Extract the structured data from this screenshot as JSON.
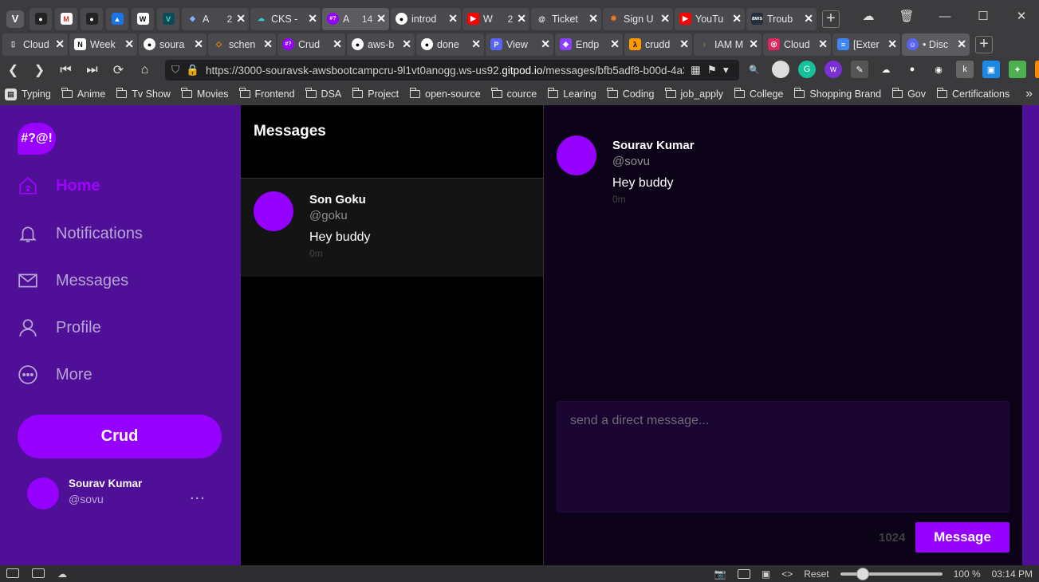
{
  "browser": {
    "tabs_row1": [
      {
        "title": "",
        "favicon": "github-icon",
        "color": "#5a5a5e"
      },
      {
        "title": "",
        "favicon": "gmail-icon",
        "color": "#5a5a5e"
      },
      {
        "title": "",
        "favicon": "github-icon",
        "color": "#5a5a5e"
      },
      {
        "title": "",
        "favicon": "google-drive-icon",
        "color": "#5a5a5e"
      },
      {
        "title": "",
        "favicon": "notion-icon",
        "color": "#5a5a5e"
      },
      {
        "title": "",
        "favicon": "vivaldi-icon",
        "color": "#5a5a5e"
      },
      {
        "title": "A",
        "count": "2",
        "favicon": "cloud-icon",
        "color": "#5a5a5e"
      },
      {
        "title": "CKS -",
        "favicon": "cloud-icon",
        "color": "#4a4a4e"
      },
      {
        "title": "A",
        "count": "14",
        "favicon": "crud-icon",
        "color": "#5b5b60",
        "active": true
      },
      {
        "title": "introd",
        "favicon": "github-icon",
        "color": "#4a4a4e"
      },
      {
        "title": "W",
        "count": "2",
        "favicon": "youtube-icon",
        "color": "#4a4a4e"
      },
      {
        "title": "Ticket",
        "favicon": "ticket-icon",
        "color": "#4a4a4e"
      },
      {
        "title": "Sign U",
        "favicon": "sign-icon",
        "color": "#4a4a4e"
      },
      {
        "title": "YouTu",
        "favicon": "youtube-icon",
        "color": "#4a4a4e"
      },
      {
        "title": "Troub",
        "favicon": "aws-icon",
        "color": "#4a4a4e"
      }
    ],
    "tabs_row2": [
      {
        "title": "Cloud",
        "favicon": "document-icon"
      },
      {
        "title": "Week",
        "favicon": "notion-icon"
      },
      {
        "title": "soura",
        "favicon": "github-icon"
      },
      {
        "title": "schen",
        "favicon": "gitpod-icon"
      },
      {
        "title": "Crud",
        "favicon": "crud-icon"
      },
      {
        "title": "aws-b",
        "favicon": "github-icon"
      },
      {
        "title": "done",
        "favicon": "github-icon"
      },
      {
        "title": "View",
        "favicon": "view-icon"
      },
      {
        "title": "Endp",
        "favicon": "endpoint-icon"
      },
      {
        "title": "crudd",
        "favicon": "lambda-icon"
      },
      {
        "title": "IAM M",
        "favicon": "iam-icon"
      },
      {
        "title": "Cloud",
        "favicon": "cloud-icon"
      },
      {
        "title": "[Exter",
        "favicon": "docs-icon"
      },
      {
        "title": "• Disc",
        "favicon": "discord-icon"
      }
    ],
    "url_prefix": "https://3000-souravsk-awsbootcampcru-9l1vt0anogg.ws-us92.",
    "url_domain": "gitpod.io",
    "url_suffix": "/messages/bfb5adf8-b00d-4a3...",
    "bookmarks": [
      "Typing",
      "Anime",
      "Tv Show",
      "Movies",
      "Frontend",
      "DSA",
      "Project",
      "open-source",
      "cource",
      "Learing",
      "Coding",
      "job_apply",
      "College",
      "Shopping Brand",
      "Gov",
      "Certifications"
    ],
    "status": {
      "reset": "Reset",
      "zoom": "100 %",
      "time": "03:14 PM"
    }
  },
  "app": {
    "logo_text": "#?@!",
    "nav": [
      {
        "label": "Home",
        "icon": "home-icon",
        "active": true
      },
      {
        "label": "Notifications",
        "icon": "bell-icon"
      },
      {
        "label": "Messages",
        "icon": "mail-icon"
      },
      {
        "label": "Profile",
        "icon": "user-icon"
      },
      {
        "label": "More",
        "icon": "more-icon"
      }
    ],
    "crud_button": "Crud",
    "current_user": {
      "name": "Sourav Kumar",
      "handle": "@sovu",
      "more": "..."
    },
    "messages_header": "Messages",
    "message_groups": [
      {
        "name": "Son Goku",
        "handle": "@goku",
        "message": "Hey buddy",
        "ago": "0m"
      }
    ],
    "conversation": [
      {
        "name": "Sourav Kumar",
        "handle": "@sovu",
        "message": "Hey buddy",
        "ago": "0m"
      }
    ],
    "composer": {
      "placeholder": "send a direct message...",
      "remaining": "1024",
      "send_label": "Message"
    },
    "colors": {
      "accent": "#9500ff",
      "sidebar": "#4f0f97"
    }
  }
}
